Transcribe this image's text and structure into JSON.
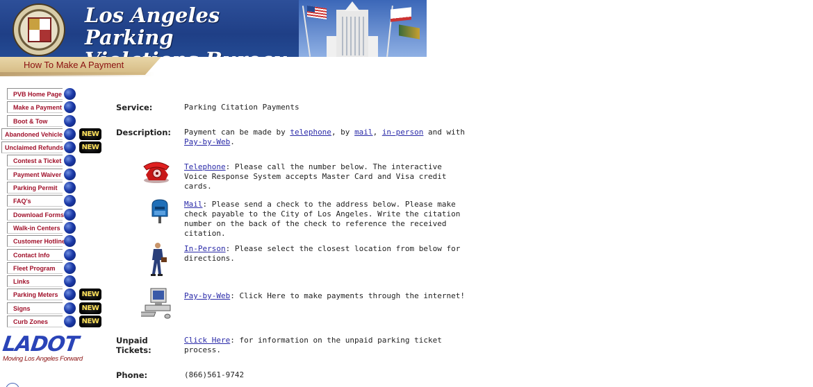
{
  "header": {
    "title_line1": "Los Angeles Parking",
    "title_line2": "Violations Bureau",
    "tab_label": "How To Make A Payment"
  },
  "nav": {
    "items": [
      {
        "label": "PVB Home Page",
        "new": false
      },
      {
        "label": "Make a Payment",
        "new": false
      },
      {
        "label": "Boot & Tow",
        "new": false
      },
      {
        "label": "Abandoned Vehicle",
        "new": true
      },
      {
        "label": "Unclaimed Refunds",
        "new": true
      },
      {
        "label": "Contest a Ticket",
        "new": false
      },
      {
        "label": "Payment Waiver",
        "new": false
      },
      {
        "label": "Parking Permit",
        "new": false
      },
      {
        "label": "FAQ's",
        "new": false
      },
      {
        "label": "Download Forms",
        "new": false
      },
      {
        "label": "Walk-in Centers",
        "new": false
      },
      {
        "label": "Customer Hotline",
        "new": false
      },
      {
        "label": "Contact Info",
        "new": false
      },
      {
        "label": "Fleet Program",
        "new": false
      },
      {
        "label": "Links",
        "new": false
      },
      {
        "label": "Parking Meters",
        "new": true
      },
      {
        "label": "Signs",
        "new": true
      },
      {
        "label": "Curb Zones",
        "new": true
      }
    ],
    "new_badge": "NEW",
    "logo_text": "LADOT",
    "logo_tagline": "Moving Los Angeles Forward"
  },
  "content": {
    "service_label": "Service:",
    "service_value": "Parking Citation Payments",
    "description_label": "Description:",
    "description": {
      "prefix": "Payment can be made by ",
      "link_telephone": "telephone",
      "sep1": ", by ",
      "link_mail": "mail",
      "sep2": ", ",
      "link_in_person": "in-person",
      "sep3": " and with ",
      "link_pay_by_web": "Pay-by-Web",
      "suffix": "."
    },
    "telephone": {
      "link": "Telephone",
      "text": ": Please call the number below. The interactive Voice Response System accepts Master Card and Visa credit cards."
    },
    "mail": {
      "link": "Mail",
      "text": ": Please send a check to the address below. Please make check payable to the City of Los Angeles. Write the citation number on the back of the check to reference the received citation."
    },
    "in_person": {
      "link": "In-Person",
      "text": ": Please select the closest location from below for directions."
    },
    "pay_by_web": {
      "link": "Pay-by-Web",
      "text": ": Click Here to make payments through the internet!"
    },
    "unpaid_label": "Unpaid Tickets:",
    "unpaid": {
      "link": "Click Here",
      "text": ": for information on the unpaid parking ticket process."
    },
    "phone_label": "Phone:",
    "phone_value": "(866)561-9742"
  },
  "colors": {
    "banner_blue": "#234a93",
    "nav_text": "#a0102a",
    "link": "#2a2aa8",
    "tab_text": "#8a0f0f",
    "new_badge_text": "#ffe25a"
  },
  "icons": [
    "city-seal-icon",
    "telephone-icon",
    "mailbox-icon",
    "walking-person-icon",
    "computer-icon"
  ]
}
